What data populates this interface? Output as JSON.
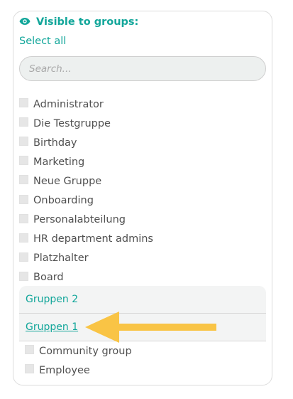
{
  "header": {
    "title": "Visible to groups:",
    "icon": "eye-icon",
    "accent_color": "#12a69a"
  },
  "select_all_label": "Select all",
  "search": {
    "placeholder": "Search...",
    "value": ""
  },
  "groups": [
    {
      "label": "Administrator",
      "checked": false
    },
    {
      "label": "Die Testgruppe",
      "checked": false
    },
    {
      "label": "Birthday",
      "checked": false
    },
    {
      "label": "Marketing",
      "checked": false
    },
    {
      "label": "Neue Gruppe",
      "checked": false
    },
    {
      "label": "Onboarding",
      "checked": false
    },
    {
      "label": "Personalabteilung",
      "checked": false
    },
    {
      "label": "HR department admins",
      "checked": false
    },
    {
      "label": "Platzhalter",
      "checked": false
    },
    {
      "label": "Board",
      "checked": false
    }
  ],
  "subgroups": [
    {
      "label": "Gruppen 2"
    },
    {
      "label": "Gruppen 1"
    }
  ],
  "subgroup_items": [
    {
      "label": "Community group",
      "checked": false
    },
    {
      "label": "Employee",
      "checked": false
    }
  ],
  "annotation": {
    "icon": "arrow-left-icon",
    "color": "#f9c445"
  }
}
